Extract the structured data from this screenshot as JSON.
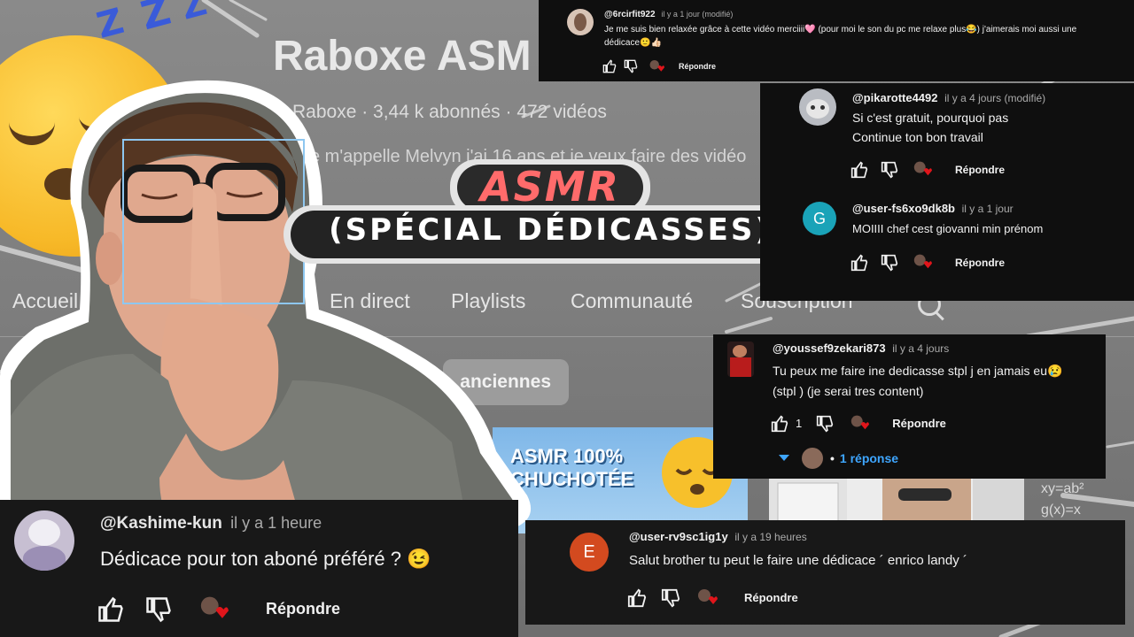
{
  "background": {
    "channel_title": "Raboxe ASM",
    "channel_meta": "Raboxe · 3,44 k abonnés · 472 vidéos",
    "channel_desc": "Je m'appelle Melvyn j'ai 16 ans et je veux faire des vidéo",
    "tabs": [
      "Accueil",
      "En direct",
      "Playlists",
      "Communauté",
      "Souscription"
    ],
    "sort_chip": "anciennes",
    "thumb1_text_line1": "ASMR 100%",
    "thumb1_text_line2": "CHUCHOTÉE",
    "thumb2_formula": "xy=ab²",
    "thumb2_formula2": "g(x)=x"
  },
  "title": {
    "line1": "ASMR",
    "line2": "(SPÉCIAL DÉDICASSES)"
  },
  "comments": [
    {
      "handle": "@6rcirfit922",
      "time": "il y a 1 jour (modifié)",
      "text_line1": "Je me suis bien relaxée grâce à cette vidéo merciiii🩷 (pour moi le son du pc me relaxe plus😂) j'aimerais moi aussi une",
      "text_line2": "dédicace🙂👍🏻",
      "reply": "Répondre"
    },
    {
      "handle": "@pikarotte4492",
      "time": "il y a 4 jours (modifié)",
      "text_line1": "Si c'est gratuit, pourquoi pas",
      "text_line2": "Continue ton bon travail",
      "reply": "Répondre"
    },
    {
      "handle": "@user-fs6xo9dk8b",
      "time": "il y a 1 jour",
      "avatar_letter": "G",
      "text_line1": "MOIIII chef cest giovanni min prénom",
      "reply": "Répondre"
    },
    {
      "handle": "@youssef9zekari873",
      "time": "il y a 4 jours",
      "text_line1": "Tu peux me faire ine dedicasse stpl j en jamais eu😢",
      "text_line2": "(stpl )     (je serai tres content)",
      "likes": "1",
      "reply": "Répondre",
      "replies": "1 réponse"
    },
    {
      "handle": "@user-rv9sc1ig1y",
      "time": "il y a 19 heures",
      "avatar_letter": "E",
      "text_line1": "Salut brother tu peut le faire une dédicace ´ enrico landy ´",
      "reply": "Répondre"
    },
    {
      "handle": "@Kashime-kun",
      "time": "il y a 1 heure",
      "text_line1": "Dédicace pour ton aboné préféré ? 😉",
      "reply": "Répondre"
    }
  ],
  "colors": {
    "accent_red": "#ff6b6b",
    "link_blue": "#3ea6ff",
    "heart_red": "#e0151b",
    "avatar_g": "#1aa3b8",
    "avatar_e": "#d34a1f"
  }
}
